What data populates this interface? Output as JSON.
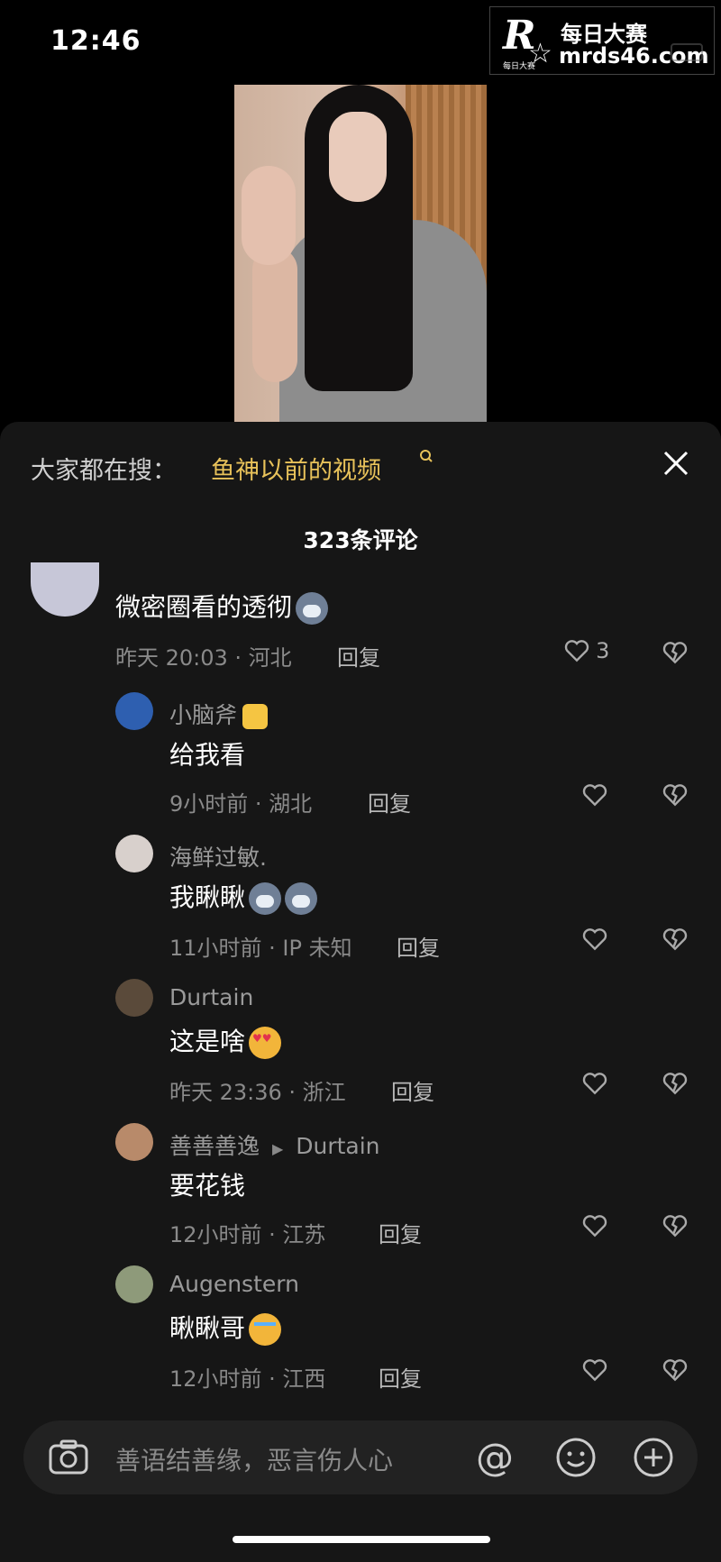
{
  "status": {
    "time": "12:46"
  },
  "watermark": {
    "logo": "R",
    "small": "每日大赛",
    "cn": "每日大赛",
    "url": "mrds46.com"
  },
  "search": {
    "label": "大家都在搜：",
    "keyword": "鱼神以前的视频"
  },
  "comments_count": "323条评论",
  "comments": [
    {
      "name": "",
      "text": "微密圈看的透彻",
      "time_loc": "昨天 20:03 · 河北",
      "reply": "回复",
      "likes": "3"
    },
    {
      "name": "小脑斧",
      "text": "给我看",
      "time_loc": "9小时前 · 湖北",
      "reply": "回复",
      "likes": ""
    },
    {
      "name": "海鲜过敏.",
      "text": "我瞅瞅",
      "time_loc": "11小时前 · IP 未知",
      "reply": "回复",
      "likes": ""
    },
    {
      "name": "Durtain",
      "text": "这是啥",
      "time_loc": "昨天 23:36 · 浙江",
      "reply": "回复",
      "likes": ""
    },
    {
      "name": "善善善逸",
      "reply_to": "Durtain",
      "text": "要花钱",
      "time_loc": "12小时前 · 江苏",
      "reply": "回复",
      "likes": ""
    },
    {
      "name": "Augenstern",
      "text": "瞅瞅哥",
      "time_loc": "12小时前 · 江西",
      "reply": "回复",
      "likes": ""
    }
  ],
  "input": {
    "placeholder": "善语结善缘，恶言伤人心"
  },
  "colors": {
    "accent": "#e8c25a",
    "sheet_bg": "#161616",
    "input_bg": "#222222"
  }
}
